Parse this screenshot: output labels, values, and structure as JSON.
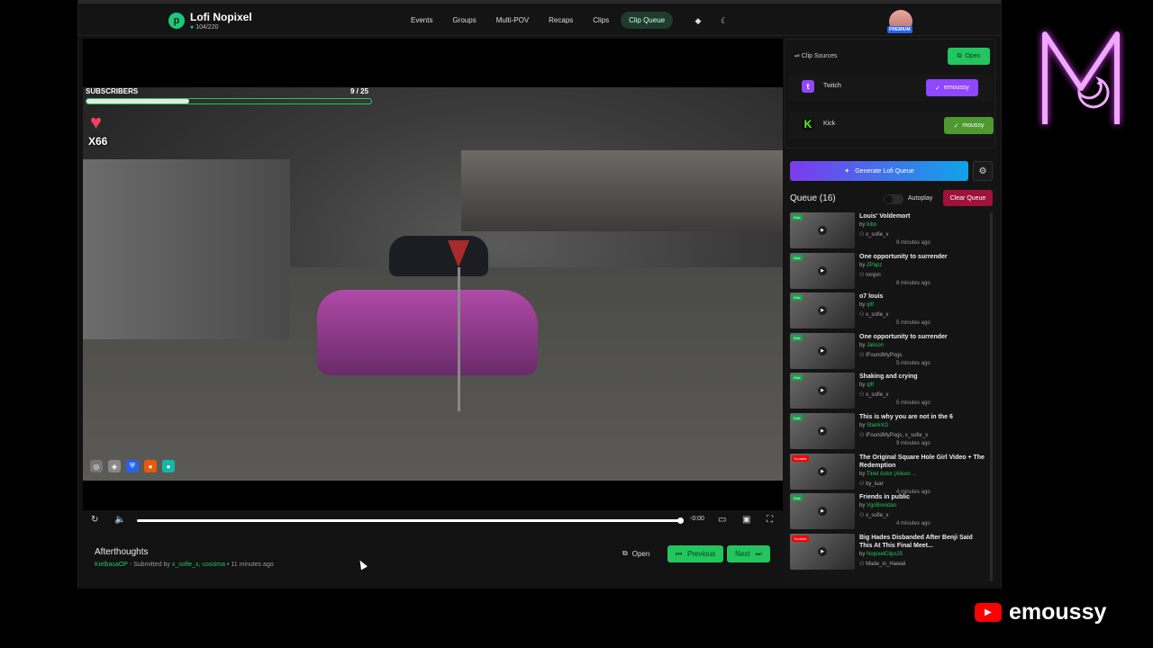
{
  "app": {
    "title": "Lofi Nopixel",
    "online_count": "104/220",
    "nav": [
      "Events",
      "Groups",
      "Multi-POV",
      "Recaps",
      "Clips",
      "Clip Queue"
    ],
    "active_tab": "Clip Queue",
    "premium_badge": "PREMIUM"
  },
  "video": {
    "hud_label": "SUBSCRIBERS",
    "hud_count": "9 / 25",
    "hud_progress": 0.36,
    "hud_multiplier": "X66",
    "playback_progress": 1.0,
    "timecode": "-0:00"
  },
  "clip": {
    "title": "Afterthoughts",
    "author": "KielbasaOP",
    "submitted_prefix": "- Submitted by",
    "submitters": "x_sofie_x, cossima",
    "age": "• 11 minutes ago",
    "open_label": "Open",
    "prev_label": "Previous",
    "next_label": "Next"
  },
  "sources": {
    "heading": "Clip Sources",
    "open_label": "Open",
    "twitch": {
      "name": "Twitch",
      "user": "emoussy",
      "color": "#9146ff"
    },
    "kick": {
      "name": "Kick",
      "user": "moussy",
      "color": "#53fc18"
    }
  },
  "queue": {
    "generate_label": "Generate Lofi Queue",
    "title": "Queue (16)",
    "autoplay_label": "Autoplay",
    "clear_label": "Clear Queue",
    "items": [
      {
        "platform": "Kick",
        "title": "Louis' Voldemort",
        "by": "by",
        "author": "bibo",
        "submitters": "x_sofie_x",
        "time": "9 minutes ago"
      },
      {
        "platform": "Kick",
        "title": "One opportunity to surrender",
        "by": "by",
        "author": "ZPapz",
        "submitters": "ronjon",
        "time": "8 minutes ago"
      },
      {
        "platform": "Kick",
        "title": "o7 louis",
        "by": "by",
        "author": "qlft",
        "submitters": "x_sofie_x",
        "time": "5 minutes ago"
      },
      {
        "platform": "Kick",
        "title": "One opportunity to surrender",
        "by": "by",
        "author": "Jakson",
        "submitters": "IFoundMyPogs",
        "time": "5 minutes ago"
      },
      {
        "platform": "Kick",
        "title": "Shaking and crying",
        "by": "by",
        "author": "qlft",
        "submitters": "x_sofie_x",
        "time": "5 minutes ago"
      },
      {
        "platform": "Kick",
        "title": "This is why you are not in the 6",
        "by": "by",
        "author": "StankXO",
        "submitters": "IFoundMyPogs, x_sofie_x",
        "time": "9 minutes ago"
      },
      {
        "platform": "Youtube",
        "title": "The Original Square Hole Girl Video + The Redemption",
        "by": "by",
        "author": "Tired Actor (Alison ...",
        "submitters": "by_luar",
        "time": "4 minutes ago"
      },
      {
        "platform": "Kick",
        "title": "Friends in public",
        "by": "by",
        "author": "VgsBrendan",
        "submitters": "x_sofie_x",
        "time": "4 minutes ago"
      },
      {
        "platform": "Youtube",
        "title": "Big Hades Disbanded After Benji Said This At This Final Meet...",
        "by": "by",
        "author": "NopixelClips25",
        "submitters": "Made_in_Hawaii",
        "time": ""
      }
    ]
  },
  "overlay": {
    "channel_name": "emoussy"
  },
  "colors": {
    "accent": "#22c55e",
    "danger": "#9f1239",
    "kick": "#53fc18",
    "twitch": "#9146ff",
    "youtube": "#ff0000"
  }
}
